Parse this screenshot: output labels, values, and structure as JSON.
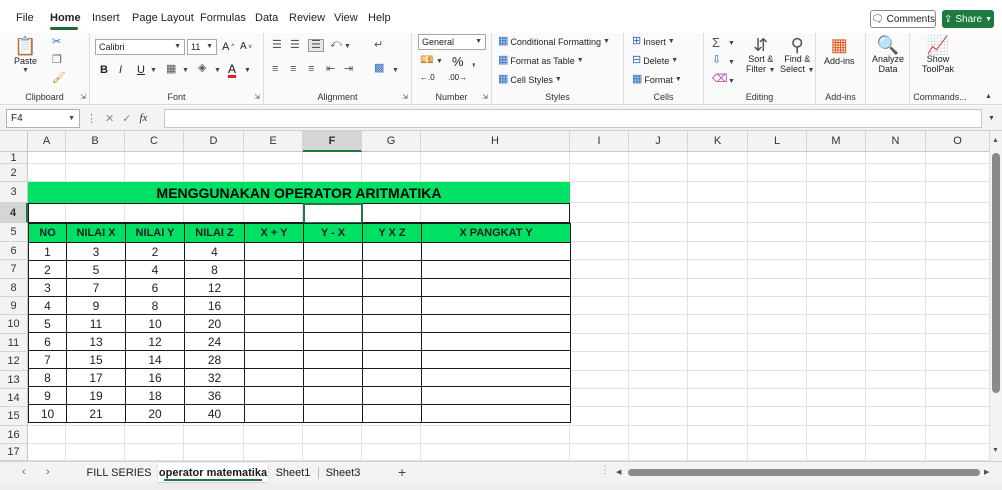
{
  "menu": {
    "tabs": [
      {
        "label": "File",
        "active": false
      },
      {
        "label": "Home",
        "active": true
      },
      {
        "label": "Insert",
        "active": false
      },
      {
        "label": "Page Layout",
        "active": false
      },
      {
        "label": "Formulas",
        "active": false
      },
      {
        "label": "Data",
        "active": false
      },
      {
        "label": "Review",
        "active": false
      },
      {
        "label": "View",
        "active": false
      },
      {
        "label": "Help",
        "active": false
      }
    ],
    "comments_label": "Comments",
    "share_label": "Share"
  },
  "ribbon": {
    "clipboard": {
      "label": "Clipboard",
      "paste_label": "Paste"
    },
    "font": {
      "label": "Font",
      "font_name": "Calibri",
      "font_size": "11",
      "bold": "B",
      "italic": "I",
      "underline": "U"
    },
    "alignment": {
      "label": "Alignment"
    },
    "number": {
      "label": "Number",
      "format": "General"
    },
    "styles": {
      "label": "Styles",
      "conditional_formatting": "Conditional Formatting",
      "format_as_table": "Format as Table",
      "cell_styles": "Cell Styles"
    },
    "cells": {
      "label": "Cells",
      "insert": "Insert",
      "delete": "Delete",
      "format": "Format"
    },
    "editing": {
      "label": "Editing",
      "sort_filter": "Sort &",
      "sort_filter_2": "Filter",
      "find_select": "Find &",
      "find_select_2": "Select"
    },
    "addins": {
      "label": "Add-ins",
      "addins_btn": "Add-ins"
    },
    "analyze": {
      "analyze_data": "Analyze",
      "analyze_data_2": "Data"
    },
    "commands": {
      "label": "Commands...",
      "show_toolpak": "Show",
      "show_toolpak_2": "ToolPak"
    }
  },
  "formula_bar": {
    "name_box": "F4",
    "fx": "fx",
    "value": ""
  },
  "grid": {
    "columns": [
      "A",
      "B",
      "C",
      "D",
      "E",
      "F",
      "G",
      "H",
      "I",
      "J",
      "K",
      "L",
      "M",
      "N",
      "O"
    ],
    "rows": [
      "1",
      "2",
      "3",
      "4",
      "5",
      "6",
      "7",
      "8",
      "9",
      "10",
      "11",
      "12",
      "13",
      "14",
      "15",
      "16",
      "17"
    ],
    "selected_column": "F",
    "selected_row": "4"
  },
  "sheet": {
    "title": "MENGGUNAKAN OPERATOR ARITMATIKA",
    "headers": [
      "NO",
      "NILAI X",
      "NILAI Y",
      "NILAI Z",
      "X + Y",
      "Y - X",
      "Y X Z",
      "X  PANGKAT Y"
    ],
    "rows": [
      [
        "1",
        "3",
        "2",
        "4",
        "",
        "",
        "",
        ""
      ],
      [
        "2",
        "5",
        "4",
        "8",
        "",
        "",
        "",
        ""
      ],
      [
        "3",
        "7",
        "6",
        "12",
        "",
        "",
        "",
        ""
      ],
      [
        "4",
        "9",
        "8",
        "16",
        "",
        "",
        "",
        ""
      ],
      [
        "5",
        "11",
        "10",
        "20",
        "",
        "",
        "",
        ""
      ],
      [
        "6",
        "13",
        "12",
        "24",
        "",
        "",
        "",
        ""
      ],
      [
        "7",
        "15",
        "14",
        "28",
        "",
        "",
        "",
        ""
      ],
      [
        "8",
        "17",
        "16",
        "32",
        "",
        "",
        "",
        ""
      ],
      [
        "9",
        "19",
        "18",
        "36",
        "",
        "",
        "",
        ""
      ],
      [
        "10",
        "21",
        "20",
        "40",
        "",
        "",
        "",
        ""
      ]
    ]
  },
  "sheet_tabs": [
    {
      "label": "FILL SERIES",
      "active": false
    },
    {
      "label": "operator matematika",
      "active": true
    },
    {
      "label": "Sheet1",
      "active": false
    },
    {
      "label": "Sheet3",
      "active": false
    }
  ],
  "colors": {
    "header_green": "#00e064",
    "accent": "#1e7a3e"
  }
}
